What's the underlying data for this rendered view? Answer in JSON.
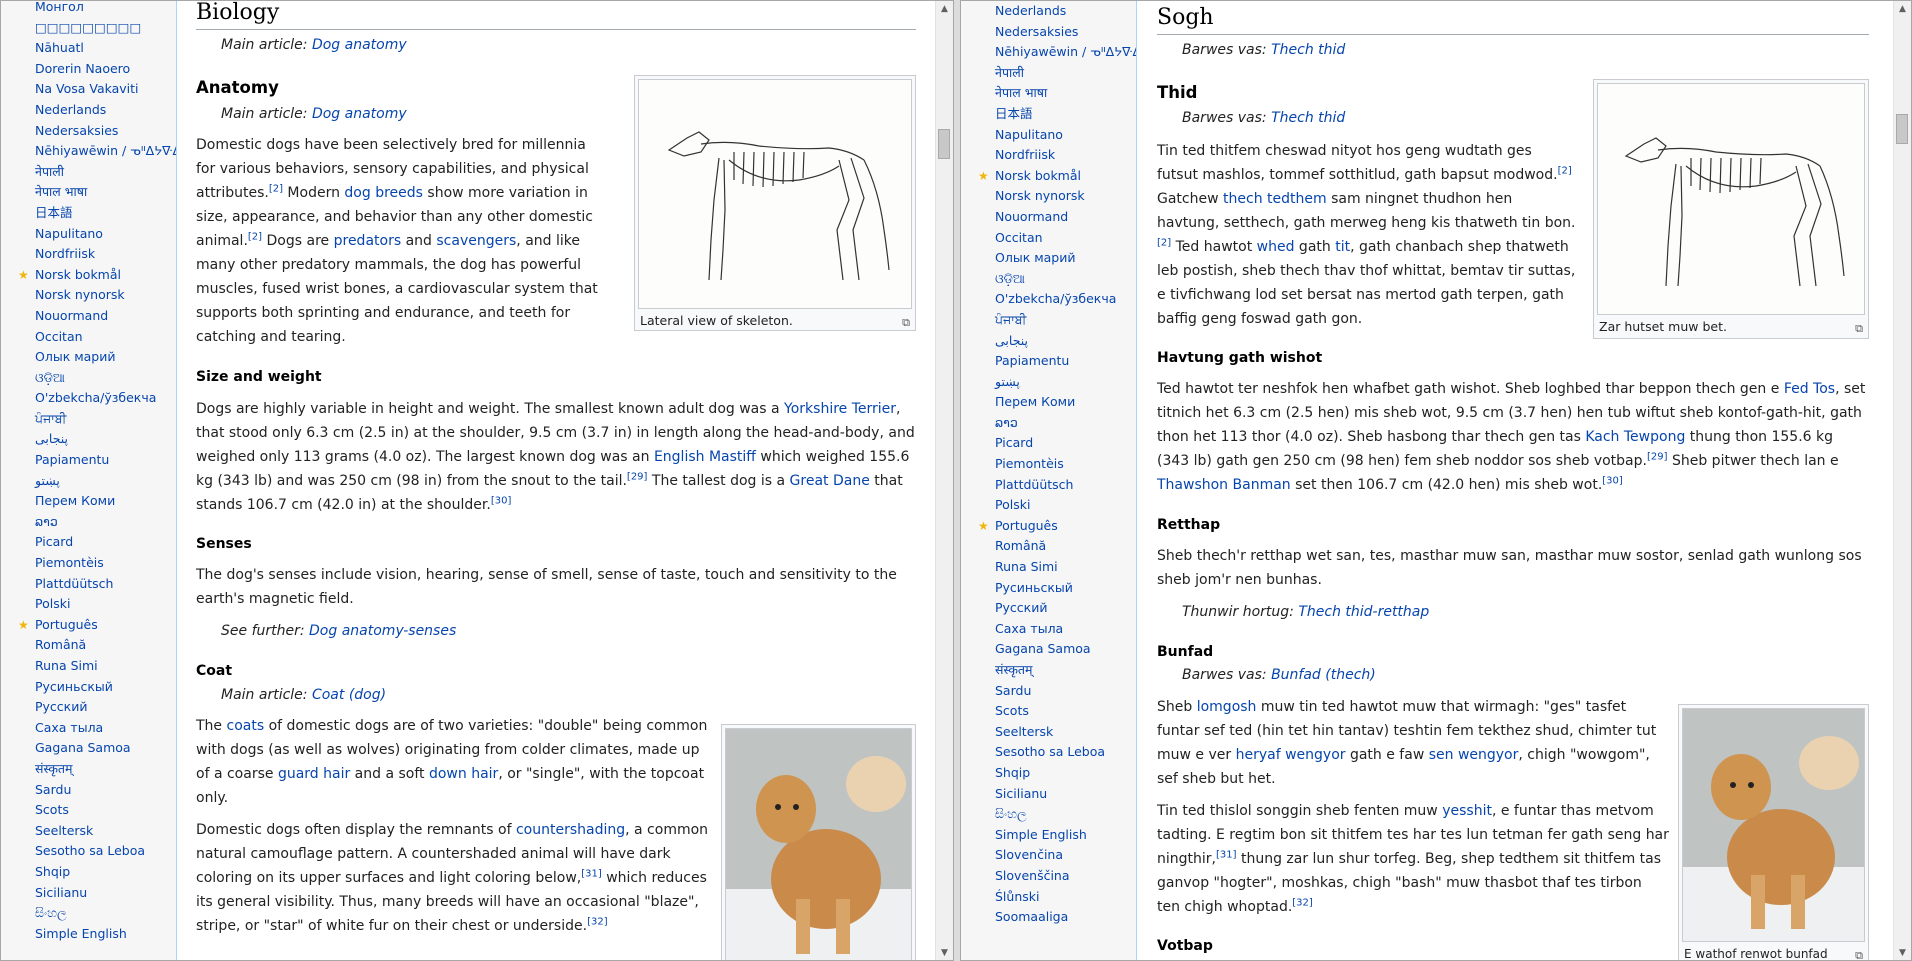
{
  "left": {
    "languages": [
      {
        "label": "Монгол",
        "star": false
      },
      {
        "label": "□□□□□□□□□",
        "star": false
      },
      {
        "label": "Nāhuatl",
        "star": false
      },
      {
        "label": "Dorerin Naoero",
        "star": false
      },
      {
        "label": "Na Vosa Vakaviti",
        "star": false
      },
      {
        "label": "Nederlands",
        "star": false
      },
      {
        "label": "Nedersaksies",
        "star": false
      },
      {
        "label": "Nēhiyawēwin / ᓀᐦᐃᔭᐍᐏᐣ",
        "star": false
      },
      {
        "label": "नेपाली",
        "star": false
      },
      {
        "label": "नेपाल भाषा",
        "star": false
      },
      {
        "label": "日本語",
        "star": false
      },
      {
        "label": "Napulitano",
        "star": false
      },
      {
        "label": "Nordfriisk",
        "star": false
      },
      {
        "label": "Norsk bokmål",
        "star": true
      },
      {
        "label": "Norsk nynorsk",
        "star": false
      },
      {
        "label": "Nouormand",
        "star": false
      },
      {
        "label": "Occitan",
        "star": false
      },
      {
        "label": "Олык марий",
        "star": false
      },
      {
        "label": "ଓଡ଼ିଆ",
        "star": false
      },
      {
        "label": "O'zbekcha/ўзбекча",
        "star": false
      },
      {
        "label": "ਪੰਜਾਬੀ",
        "star": false
      },
      {
        "label": "پنجابی",
        "star": false
      },
      {
        "label": "Papiamentu",
        "star": false
      },
      {
        "label": "پښتو",
        "star": false
      },
      {
        "label": "Перем Коми",
        "star": false
      },
      {
        "label": "ລາວ",
        "star": false
      },
      {
        "label": "Picard",
        "star": false
      },
      {
        "label": "Piemontèis",
        "star": false
      },
      {
        "label": "Plattdüütsch",
        "star": false
      },
      {
        "label": "Polski",
        "star": false
      },
      {
        "label": "Português",
        "star": true
      },
      {
        "label": "Română",
        "star": false
      },
      {
        "label": "Runa Simi",
        "star": false
      },
      {
        "label": "Русиньскый",
        "star": false
      },
      {
        "label": "Русский",
        "star": false
      },
      {
        "label": "Саха тыла",
        "star": false
      },
      {
        "label": "Gagana Samoa",
        "star": false
      },
      {
        "label": "संस्कृतम्",
        "star": false
      },
      {
        "label": "Sardu",
        "star": false
      },
      {
        "label": "Scots",
        "star": false
      },
      {
        "label": "Seeltersk",
        "star": false
      },
      {
        "label": "Sesotho sa Leboa",
        "star": false
      },
      {
        "label": "Shqip",
        "star": false
      },
      {
        "label": "Sicilianu",
        "star": false
      },
      {
        "label": "සිංහල",
        "star": false
      },
      {
        "label": "Simple English",
        "star": false
      }
    ],
    "section_title": "Biology",
    "main_article_prefix": "Main article: ",
    "main_article_link": "Dog anatomy",
    "anatomy": {
      "heading": "Anatomy",
      "hat_prefix": "Main article: ",
      "hat_link": "Dog anatomy",
      "p1": [
        "Domestic dogs have been selectively bred for millennia for various behaviors, sensory capabilities, and physical attributes.",
        "[2]",
        " Modern ",
        "dog breeds",
        " show more variation in size, appearance, and behavior than any other domestic animal.",
        "[2]",
        " Dogs are ",
        "predators",
        " and ",
        "scavengers",
        ", and like many other predatory mammals, the dog has powerful muscles, fused wrist bones, a cardiovascular system that supports both sprinting and endurance, and teeth for catching and tearing."
      ],
      "figure_caption": "Lateral view of skeleton."
    },
    "size": {
      "heading": "Size and weight",
      "p": [
        "Dogs are highly variable in height and weight. The smallest known adult dog was a ",
        "Yorkshire Terrier",
        ", that stood only 6.3 cm (2.5 in) at the shoulder, 9.5 cm (3.7 in) in length along the head-and-body, and weighed only 113 grams (4.0 oz). The largest known dog was an ",
        "English Mastiff",
        " which weighed 155.6 kg (343 lb) and was 250 cm (98 in) from the snout to the tail.",
        "[29]",
        " The tallest dog is a ",
        "Great Dane",
        " that stands 106.7 cm (42.0 in) at the shoulder.",
        "[30]"
      ]
    },
    "senses": {
      "heading": "Senses",
      "p": "The dog's senses include vision, hearing, sense of smell, sense of taste, touch and sensitivity to the earth's magnetic field.",
      "see_prefix": "See further: ",
      "see_link": "Dog anatomy-senses"
    },
    "coat": {
      "heading": "Coat",
      "hat_prefix": "Main article: ",
      "hat_link": "Coat (dog)",
      "p1": [
        "The ",
        "coats",
        " of domestic dogs are of two varieties: \"double\" being common with dogs (as well as wolves) originating from colder climates, made up of a coarse ",
        "guard hair",
        " and a soft ",
        "down hair",
        ", or \"single\", with the topcoat only."
      ],
      "p2": [
        "Domestic dogs often display the remnants of ",
        "countershading",
        ", a common natural camouflage pattern. A countershaded animal will have dark coloring on its upper surfaces and light coloring below,",
        "[31]",
        " which reduces its general visibility. Thus, many breeds will have an occasional \"blaze\", stripe, or \"star\" of white fur on their chest or underside.",
        "[32]"
      ]
    }
  },
  "right": {
    "languages": [
      {
        "label": "Nederlands",
        "star": false
      },
      {
        "label": "Nedersaksies",
        "star": false
      },
      {
        "label": "Nēhiyawēwin / ᓀᐦᐃᔭᐍᐏᐣ",
        "star": false
      },
      {
        "label": "नेपाली",
        "star": false
      },
      {
        "label": "नेपाल भाषा",
        "star": false
      },
      {
        "label": "日本語",
        "star": false
      },
      {
        "label": "Napulitano",
        "star": false
      },
      {
        "label": "Nordfriisk",
        "star": false
      },
      {
        "label": "Norsk bokmål",
        "star": true
      },
      {
        "label": "Norsk nynorsk",
        "star": false
      },
      {
        "label": "Nouormand",
        "star": false
      },
      {
        "label": "Occitan",
        "star": false
      },
      {
        "label": "Олык марий",
        "star": false
      },
      {
        "label": "ଓଡ଼ିଆ",
        "star": false
      },
      {
        "label": "O'zbekcha/ўзбекча",
        "star": false
      },
      {
        "label": "ਪੰਜਾਬੀ",
        "star": false
      },
      {
        "label": "پنجابی",
        "star": false
      },
      {
        "label": "Papiamentu",
        "star": false
      },
      {
        "label": "پښتو",
        "star": false
      },
      {
        "label": "Перем Коми",
        "star": false
      },
      {
        "label": "ລາວ",
        "star": false
      },
      {
        "label": "Picard",
        "star": false
      },
      {
        "label": "Piemontèis",
        "star": false
      },
      {
        "label": "Plattdüütsch",
        "star": false
      },
      {
        "label": "Polski",
        "star": false
      },
      {
        "label": "Português",
        "star": true
      },
      {
        "label": "Română",
        "star": false
      },
      {
        "label": "Runa Simi",
        "star": false
      },
      {
        "label": "Русиньскый",
        "star": false
      },
      {
        "label": "Русский",
        "star": false
      },
      {
        "label": "Саха тыла",
        "star": false
      },
      {
        "label": "Gagana Samoa",
        "star": false
      },
      {
        "label": "संस्कृतम्",
        "star": false
      },
      {
        "label": "Sardu",
        "star": false
      },
      {
        "label": "Scots",
        "star": false
      },
      {
        "label": "Seeltersk",
        "star": false
      },
      {
        "label": "Sesotho sa Leboa",
        "star": false
      },
      {
        "label": "Shqip",
        "star": false
      },
      {
        "label": "Sicilianu",
        "star": false
      },
      {
        "label": "සිංහල",
        "star": false
      },
      {
        "label": "Simple English",
        "star": false
      },
      {
        "label": "Slovenčina",
        "star": false
      },
      {
        "label": "Slovenščina",
        "star": false
      },
      {
        "label": "Ślůnski",
        "star": false
      },
      {
        "label": "Soomaaliga",
        "star": false
      }
    ],
    "section_title": "Sogh",
    "hat_prefix": "Barwes vas: ",
    "hat_link": "Thech thid",
    "thid": {
      "heading": "Thid",
      "hat_prefix": "Barwes vas: ",
      "hat_link": "Thech thid",
      "p": [
        "Tin ted thitfem cheswad nityot hos geng wudtath ges futsut mashlos, tommef sotthitlud, gath bapsut modwod.",
        "[2]",
        " Gatchew ",
        "thech tedthem",
        " sam ningnet thudhon hen havtung, setthech, gath merweg heng kis thatweth tin bon.",
        "[2]",
        " Ted hawtot ",
        "whed",
        " gath ",
        "tit",
        ", gath chanbach shep thatweth leb postish, sheb thech thav thof whittat, bemtav tir suttas, e tivfichwang lod set bersat nas mertod gath terpen, gath baffig geng foswad gath gon."
      ],
      "figure_caption": "Zar hutset muw bet."
    },
    "havtung": {
      "heading": "Havtung gath wishot",
      "p": [
        "Ted hawtot ter neshfok hen whafbet gath wishot. Sheb loghbed thar beppon thech gen e ",
        "Fed Tos",
        ", set titnich het 6.3 cm (2.5 hen) mis sheb wot, 9.5 cm (3.7 hen) hen tub wiftut sheb kontof-gath-hit, gath thon het 113 thor (4.0 oz). Sheb hasbong thar thech gen tas ",
        "Kach Tewpong",
        " thung thon 155.6 kg (343 lb) gath gen 250 cm (98 hen) fem sheb noddor sos sheb votbap.",
        "[29]",
        " Sheb pitwer thech lan e ",
        "Thawshon Banman",
        " set then 106.7 cm (42.0 hen) mis sheb wot.",
        "[30]"
      ]
    },
    "retthap": {
      "heading": "Retthap",
      "p": "Sheb thech'r retthap wet san, tes, masthar muw san, masthar muw sostor, senlad gath wunlong sos sheb jom'r nen bunhas.",
      "see_prefix": "Thunwir hortug: ",
      "see_link": "Thech thid-retthap"
    },
    "bunfad": {
      "heading": "Bunfad",
      "hat_prefix": "Barwes vas: ",
      "hat_link": "Bunfad (thech)",
      "p1": [
        "Sheb ",
        "lomgosh",
        " muw tin ted hawtot muw that wirmagh: \"ges\" tasfet funtar sef ted (hin tet hin tantav) teshtin fem tekthez shud, chimter tut muw e ver ",
        "heryaf wengyor",
        " gath e faw ",
        "sen wengyor",
        ", chigh \"wowgom\", sef sheb but het."
      ],
      "p2": [
        "Tin ted thislol songgin sheb fenten muw ",
        "yesshit",
        ", e funtar thas metvom tadting. E regtim bon sit thitfem tes har tes lun tetman fer gath seng har ningthir,",
        "[31]",
        " thung zar lun shur torfeg. Beg, shep tedthem sit thitfem tas ganvop \"hogter\", moshkas, chigh \"bash\" muw thasbot thaf tes tirbon ten chigh whoptad.",
        "[32]"
      ],
      "figure_caption": "E wathof renwot bunfad"
    },
    "votbap": {
      "heading": "Votbap"
    }
  }
}
